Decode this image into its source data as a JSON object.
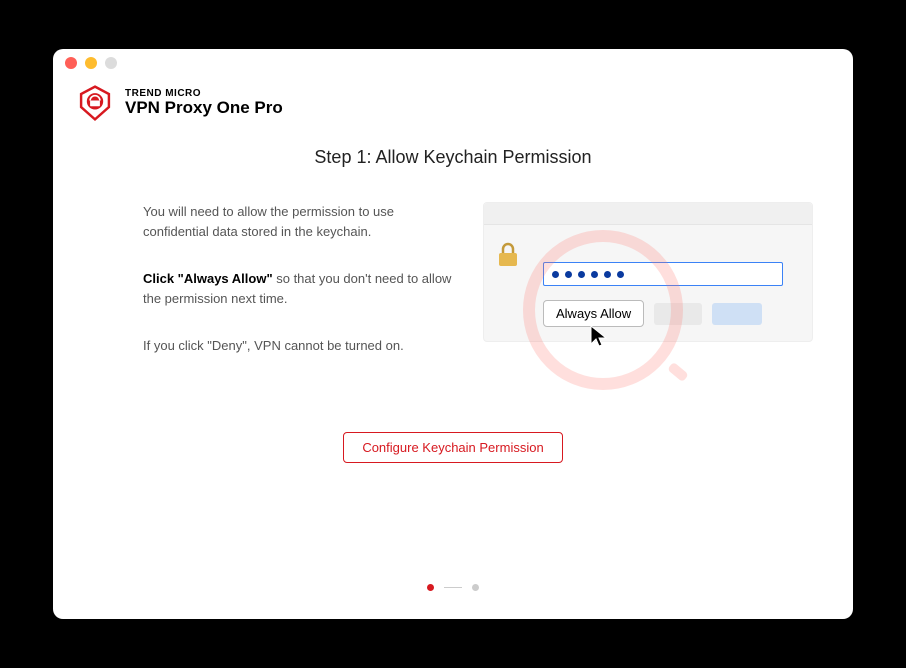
{
  "brand": {
    "top": "TREND MICRO",
    "bottom": "VPN Proxy One Pro"
  },
  "stepTitle": "Step 1: Allow Keychain Permission",
  "instructions": {
    "para1": "You will need to allow the permission to use confidential data stored in the keychain.",
    "para2_bold": "Click \"Always Allow\"",
    "para2_rest": " so that you don't need to allow the permission next time.",
    "para3": "If you click \"Deny\", VPN cannot be turned on."
  },
  "illustration": {
    "alwaysAllowLabel": "Always Allow",
    "passwordDots": 6
  },
  "cta": {
    "label": "Configure Keychain Permission"
  },
  "pager": {
    "total": 2,
    "current": 1
  }
}
